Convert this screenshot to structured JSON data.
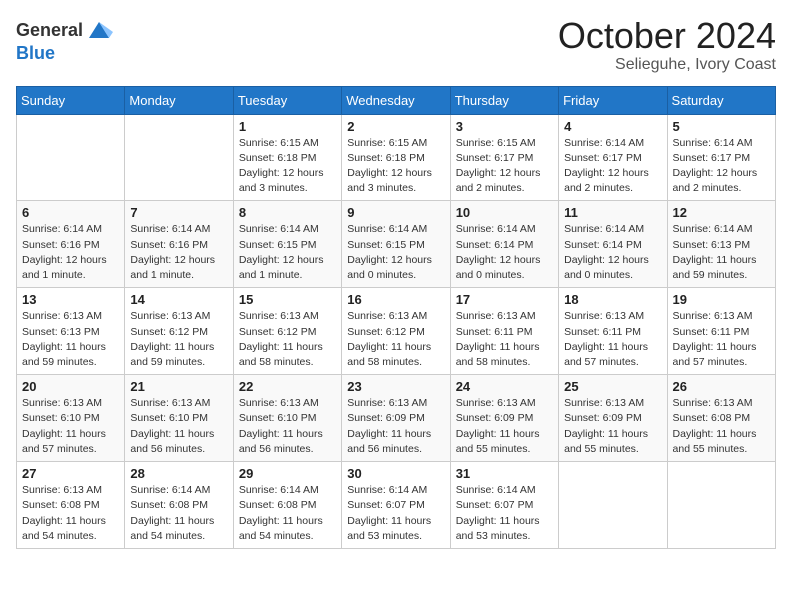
{
  "header": {
    "logo_general": "General",
    "logo_blue": "Blue",
    "month_title": "October 2024",
    "location": "Selieguhe, Ivory Coast"
  },
  "days_of_week": [
    "Sunday",
    "Monday",
    "Tuesday",
    "Wednesday",
    "Thursday",
    "Friday",
    "Saturday"
  ],
  "weeks": [
    [
      {
        "day": "",
        "info": ""
      },
      {
        "day": "",
        "info": ""
      },
      {
        "day": "1",
        "info": "Sunrise: 6:15 AM\nSunset: 6:18 PM\nDaylight: 12 hours and 3 minutes."
      },
      {
        "day": "2",
        "info": "Sunrise: 6:15 AM\nSunset: 6:18 PM\nDaylight: 12 hours and 3 minutes."
      },
      {
        "day": "3",
        "info": "Sunrise: 6:15 AM\nSunset: 6:17 PM\nDaylight: 12 hours and 2 minutes."
      },
      {
        "day": "4",
        "info": "Sunrise: 6:14 AM\nSunset: 6:17 PM\nDaylight: 12 hours and 2 minutes."
      },
      {
        "day": "5",
        "info": "Sunrise: 6:14 AM\nSunset: 6:17 PM\nDaylight: 12 hours and 2 minutes."
      }
    ],
    [
      {
        "day": "6",
        "info": "Sunrise: 6:14 AM\nSunset: 6:16 PM\nDaylight: 12 hours and 1 minute."
      },
      {
        "day": "7",
        "info": "Sunrise: 6:14 AM\nSunset: 6:16 PM\nDaylight: 12 hours and 1 minute."
      },
      {
        "day": "8",
        "info": "Sunrise: 6:14 AM\nSunset: 6:15 PM\nDaylight: 12 hours and 1 minute."
      },
      {
        "day": "9",
        "info": "Sunrise: 6:14 AM\nSunset: 6:15 PM\nDaylight: 12 hours and 0 minutes."
      },
      {
        "day": "10",
        "info": "Sunrise: 6:14 AM\nSunset: 6:14 PM\nDaylight: 12 hours and 0 minutes."
      },
      {
        "day": "11",
        "info": "Sunrise: 6:14 AM\nSunset: 6:14 PM\nDaylight: 12 hours and 0 minutes."
      },
      {
        "day": "12",
        "info": "Sunrise: 6:14 AM\nSunset: 6:13 PM\nDaylight: 11 hours and 59 minutes."
      }
    ],
    [
      {
        "day": "13",
        "info": "Sunrise: 6:13 AM\nSunset: 6:13 PM\nDaylight: 11 hours and 59 minutes."
      },
      {
        "day": "14",
        "info": "Sunrise: 6:13 AM\nSunset: 6:12 PM\nDaylight: 11 hours and 59 minutes."
      },
      {
        "day": "15",
        "info": "Sunrise: 6:13 AM\nSunset: 6:12 PM\nDaylight: 11 hours and 58 minutes."
      },
      {
        "day": "16",
        "info": "Sunrise: 6:13 AM\nSunset: 6:12 PM\nDaylight: 11 hours and 58 minutes."
      },
      {
        "day": "17",
        "info": "Sunrise: 6:13 AM\nSunset: 6:11 PM\nDaylight: 11 hours and 58 minutes."
      },
      {
        "day": "18",
        "info": "Sunrise: 6:13 AM\nSunset: 6:11 PM\nDaylight: 11 hours and 57 minutes."
      },
      {
        "day": "19",
        "info": "Sunrise: 6:13 AM\nSunset: 6:11 PM\nDaylight: 11 hours and 57 minutes."
      }
    ],
    [
      {
        "day": "20",
        "info": "Sunrise: 6:13 AM\nSunset: 6:10 PM\nDaylight: 11 hours and 57 minutes."
      },
      {
        "day": "21",
        "info": "Sunrise: 6:13 AM\nSunset: 6:10 PM\nDaylight: 11 hours and 56 minutes."
      },
      {
        "day": "22",
        "info": "Sunrise: 6:13 AM\nSunset: 6:10 PM\nDaylight: 11 hours and 56 minutes."
      },
      {
        "day": "23",
        "info": "Sunrise: 6:13 AM\nSunset: 6:09 PM\nDaylight: 11 hours and 56 minutes."
      },
      {
        "day": "24",
        "info": "Sunrise: 6:13 AM\nSunset: 6:09 PM\nDaylight: 11 hours and 55 minutes."
      },
      {
        "day": "25",
        "info": "Sunrise: 6:13 AM\nSunset: 6:09 PM\nDaylight: 11 hours and 55 minutes."
      },
      {
        "day": "26",
        "info": "Sunrise: 6:13 AM\nSunset: 6:08 PM\nDaylight: 11 hours and 55 minutes."
      }
    ],
    [
      {
        "day": "27",
        "info": "Sunrise: 6:13 AM\nSunset: 6:08 PM\nDaylight: 11 hours and 54 minutes."
      },
      {
        "day": "28",
        "info": "Sunrise: 6:14 AM\nSunset: 6:08 PM\nDaylight: 11 hours and 54 minutes."
      },
      {
        "day": "29",
        "info": "Sunrise: 6:14 AM\nSunset: 6:08 PM\nDaylight: 11 hours and 54 minutes."
      },
      {
        "day": "30",
        "info": "Sunrise: 6:14 AM\nSunset: 6:07 PM\nDaylight: 11 hours and 53 minutes."
      },
      {
        "day": "31",
        "info": "Sunrise: 6:14 AM\nSunset: 6:07 PM\nDaylight: 11 hours and 53 minutes."
      },
      {
        "day": "",
        "info": ""
      },
      {
        "day": "",
        "info": ""
      }
    ]
  ]
}
